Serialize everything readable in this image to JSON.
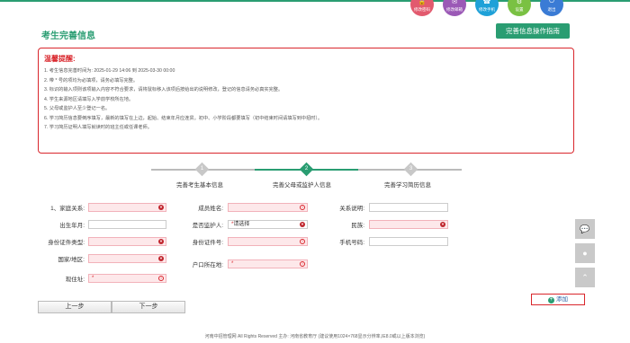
{
  "header": {
    "buttons": [
      {
        "label": "修改密码",
        "icon": "lock-icon",
        "color": "#e25a6e"
      },
      {
        "label": "修改邮箱",
        "icon": "mail-icon",
        "color": "#9b59b6"
      },
      {
        "label": "修改手机",
        "icon": "phone-icon",
        "color": "#1ea1d8"
      },
      {
        "label": "设置",
        "icon": "gear-icon",
        "color": "#7ac143"
      },
      {
        "label": "退出",
        "icon": "power-icon",
        "color": "#3a7bd5"
      }
    ]
  },
  "page": {
    "title": "考生完善信息",
    "guide_button": "完善信息操作指南"
  },
  "tips": {
    "title": "温馨提醒:",
    "items": [
      "1. 考生信息完善时间为: 2025-01-29 14:06 到 2025-03-30 00:00",
      "2. 带 * 号的项均为必填项，请务必填写完整。",
      "3. 标识的输入项则该项输入内容不符合要求，请将鼠标移入该项后按给出的说明修改，登记的信息请务必真实完整。",
      "4. 学生来源地区请填写入学前学校所在地。",
      "5. 父母或监护人至少登记一名。",
      "6. 学习简历信息要倒序填写，最新的填写在上边，起始、结束年月应连贯。初中、小学阶段都要填写（初中结束时间请填写到中招时）。",
      "7. 学习简历证明人填写就读时的班主任或任课老师。"
    ]
  },
  "steps": [
    {
      "num": "1",
      "label": "完善考生基本信息",
      "active": false
    },
    {
      "num": "2",
      "label": "完善父母或监护人信息",
      "active": true
    },
    {
      "num": "3",
      "label": "完善学习简历信息",
      "active": false
    }
  ],
  "form": {
    "relation_label": "1、家庭关系:",
    "member_name_label": "成员姓名:",
    "relation_desc_label": "关系说明:",
    "birth_label": "出生年月:",
    "guardian_label": "是否监护人:",
    "guardian_value": "请选择",
    "ethnic_label": "民族:",
    "id_type_label": "身份证件类型:",
    "id_number_label": "身份证件号:",
    "phone_label": "手机号码:",
    "country_label": "国家/地区:",
    "hukou_label": "户口所在地:",
    "address_label": "现住址:",
    "required_star": "*"
  },
  "actions": {
    "add_label": "添加",
    "prev_label": "上一步",
    "next_label": "下一步"
  },
  "footer": {
    "text": "河南中招管理网 All Rights Reserved 主办: 河南省教育厅 (建议使用1024×768显示分辨率,IE8.0或以上版本浏览)"
  },
  "colors": {
    "brand_green": "#2a9d72",
    "alert_red": "#d9262c"
  }
}
